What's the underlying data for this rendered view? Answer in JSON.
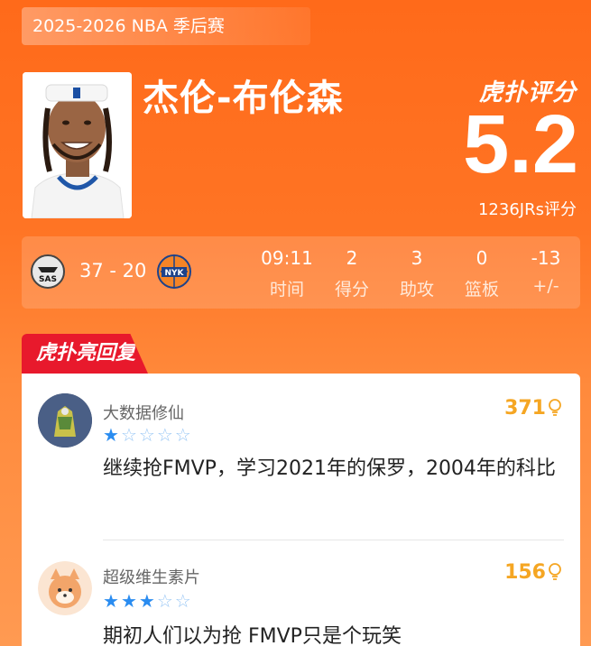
{
  "header": {
    "season": "2025-2026 NBA 季后赛"
  },
  "player": {
    "name": "杰伦-布伦森",
    "rating_brand": "虎扑评分",
    "score": "5.2",
    "votes": "1236JRs评分"
  },
  "game": {
    "home_team": "SAS",
    "away_team": "NYK",
    "score": "37 - 20",
    "stats": [
      {
        "value": "09:11",
        "label": "时间"
      },
      {
        "value": "2",
        "label": "得分"
      },
      {
        "value": "3",
        "label": "助攻"
      },
      {
        "value": "0",
        "label": "篮板"
      },
      {
        "value": "-13",
        "label": "+/-"
      }
    ]
  },
  "comments_section": {
    "tab_label": "虎扑亮回复",
    "items": [
      {
        "username": "大数据修仙",
        "likes": "371",
        "stars": 1,
        "text": "继续抢FMVP，学习2021年的保罗，2004年的科比"
      },
      {
        "username": "超级维生素片",
        "likes": "156",
        "stars": 3,
        "text": "期初人们以为抢 FMVP只是个玩笑"
      }
    ]
  },
  "colors": {
    "background": "#ff7424",
    "accent_red": "#e8192c",
    "likes": "#f5a623",
    "star": "#2a8cf0"
  }
}
